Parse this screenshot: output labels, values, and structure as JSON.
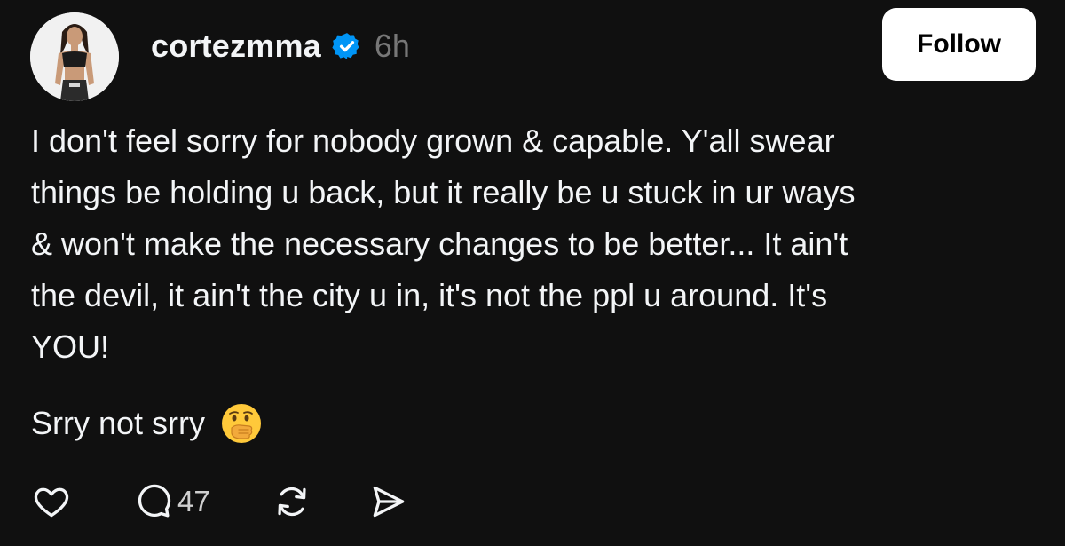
{
  "post": {
    "username": "cortezmma",
    "timestamp": "6h",
    "follow_label": "Follow",
    "body": "I don't feel sorry for nobody grown & capable. Y'all swear\nthings be holding u back, but it really be u stuck in ur ways\n& won't make the necessary changes to be better... It ain't\nthe devil, it ain't the city u in, it's not the ppl u around. It's\nYOU!",
    "body_2": "Srry not srry",
    "emoji": "face-with-hand-over-mouth",
    "replies_count": "47"
  },
  "icons": {
    "like": "heart-icon",
    "reply": "comment-bubble-icon",
    "repost": "repost-arrows-icon",
    "share": "send-icon",
    "verified": "verified-badge-icon"
  },
  "colors": {
    "background": "#101010",
    "text": "#f3f5f7",
    "muted": "#777777",
    "verified": "#0095f6",
    "follow_bg": "#ffffff"
  }
}
